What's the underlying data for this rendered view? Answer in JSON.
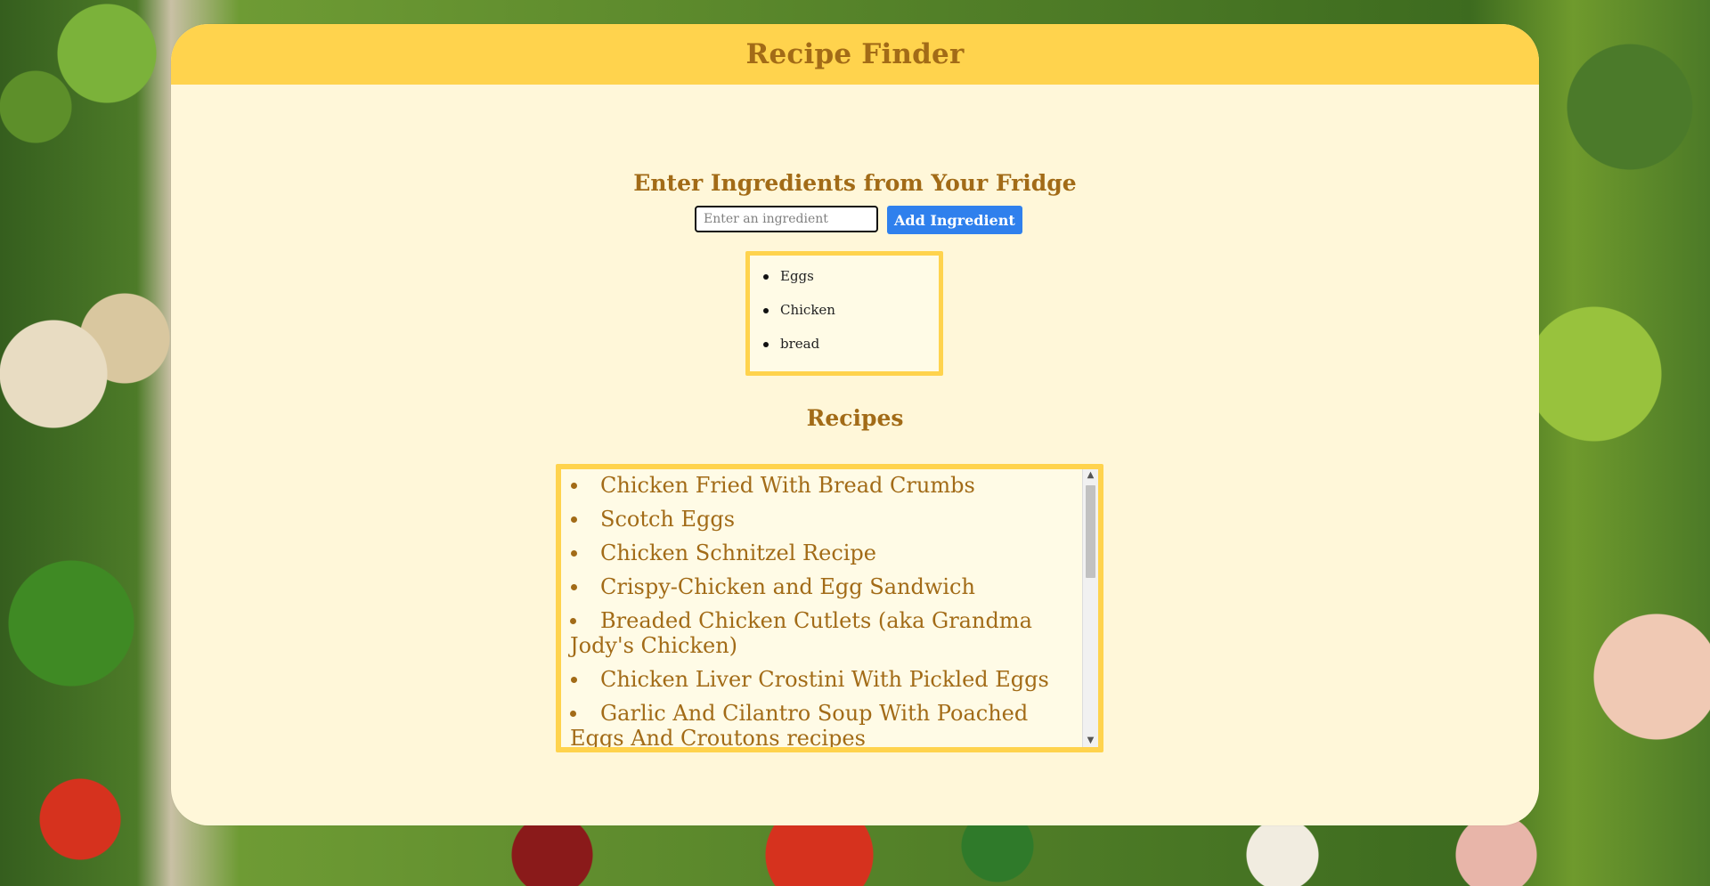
{
  "header": {
    "title": "Recipe Finder"
  },
  "ingredients_section": {
    "title": "Enter Ingredients from Your Fridge",
    "input_placeholder": "Enter an ingredient",
    "button_label": "Add Ingredient",
    "items": [
      "Eggs",
      "Chicken",
      "bread"
    ]
  },
  "recipes_section": {
    "title": "Recipes",
    "items": [
      "Chicken Fried With Bread Crumbs",
      "Scotch Eggs",
      "Chicken Schnitzel Recipe",
      "Crispy-Chicken and Egg Sandwich",
      "Breaded Chicken Cutlets (aka Grandma Jody's Chicken)",
      "Chicken Liver Crostini With Pickled Eggs",
      "Garlic And Cilantro Soup With Poached Eggs And Croutons recipes"
    ]
  },
  "colors": {
    "header_bg": "#ffd34d",
    "panel_bg": "#fff7d9",
    "title_text": "#a26b17",
    "button_bg": "#2f80ed",
    "box_border": "#ffd34d"
  },
  "icons": {
    "scroll_up": "scroll-up-arrow-icon",
    "scroll_down": "scroll-down-arrow-icon",
    "bullet": "bullet-icon"
  }
}
